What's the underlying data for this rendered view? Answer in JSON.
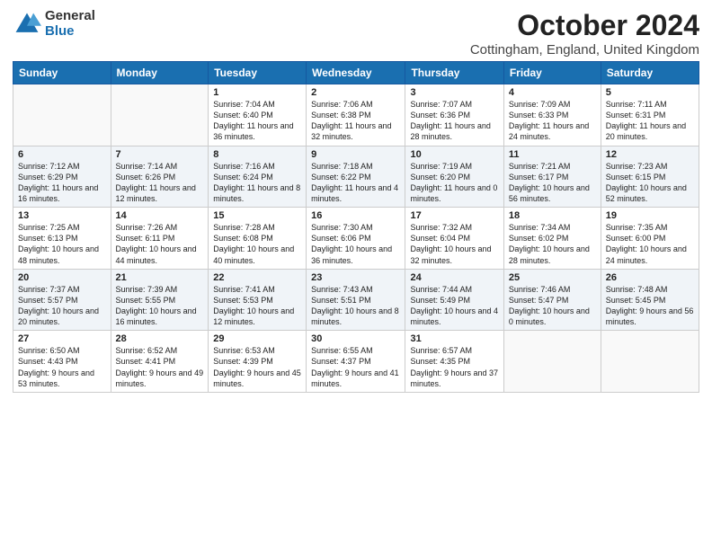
{
  "logo": {
    "general": "General",
    "blue": "Blue"
  },
  "header": {
    "title": "October 2024",
    "subtitle": "Cottingham, England, United Kingdom"
  },
  "weekdays": [
    "Sunday",
    "Monday",
    "Tuesday",
    "Wednesday",
    "Thursday",
    "Friday",
    "Saturday"
  ],
  "weeks": [
    [
      null,
      null,
      {
        "day": "1",
        "sunrise": "Sunrise: 7:04 AM",
        "sunset": "Sunset: 6:40 PM",
        "daylight": "Daylight: 11 hours and 36 minutes."
      },
      {
        "day": "2",
        "sunrise": "Sunrise: 7:06 AM",
        "sunset": "Sunset: 6:38 PM",
        "daylight": "Daylight: 11 hours and 32 minutes."
      },
      {
        "day": "3",
        "sunrise": "Sunrise: 7:07 AM",
        "sunset": "Sunset: 6:36 PM",
        "daylight": "Daylight: 11 hours and 28 minutes."
      },
      {
        "day": "4",
        "sunrise": "Sunrise: 7:09 AM",
        "sunset": "Sunset: 6:33 PM",
        "daylight": "Daylight: 11 hours and 24 minutes."
      },
      {
        "day": "5",
        "sunrise": "Sunrise: 7:11 AM",
        "sunset": "Sunset: 6:31 PM",
        "daylight": "Daylight: 11 hours and 20 minutes."
      }
    ],
    [
      {
        "day": "6",
        "sunrise": "Sunrise: 7:12 AM",
        "sunset": "Sunset: 6:29 PM",
        "daylight": "Daylight: 11 hours and 16 minutes."
      },
      {
        "day": "7",
        "sunrise": "Sunrise: 7:14 AM",
        "sunset": "Sunset: 6:26 PM",
        "daylight": "Daylight: 11 hours and 12 minutes."
      },
      {
        "day": "8",
        "sunrise": "Sunrise: 7:16 AM",
        "sunset": "Sunset: 6:24 PM",
        "daylight": "Daylight: 11 hours and 8 minutes."
      },
      {
        "day": "9",
        "sunrise": "Sunrise: 7:18 AM",
        "sunset": "Sunset: 6:22 PM",
        "daylight": "Daylight: 11 hours and 4 minutes."
      },
      {
        "day": "10",
        "sunrise": "Sunrise: 7:19 AM",
        "sunset": "Sunset: 6:20 PM",
        "daylight": "Daylight: 11 hours and 0 minutes."
      },
      {
        "day": "11",
        "sunrise": "Sunrise: 7:21 AM",
        "sunset": "Sunset: 6:17 PM",
        "daylight": "Daylight: 10 hours and 56 minutes."
      },
      {
        "day": "12",
        "sunrise": "Sunrise: 7:23 AM",
        "sunset": "Sunset: 6:15 PM",
        "daylight": "Daylight: 10 hours and 52 minutes."
      }
    ],
    [
      {
        "day": "13",
        "sunrise": "Sunrise: 7:25 AM",
        "sunset": "Sunset: 6:13 PM",
        "daylight": "Daylight: 10 hours and 48 minutes."
      },
      {
        "day": "14",
        "sunrise": "Sunrise: 7:26 AM",
        "sunset": "Sunset: 6:11 PM",
        "daylight": "Daylight: 10 hours and 44 minutes."
      },
      {
        "day": "15",
        "sunrise": "Sunrise: 7:28 AM",
        "sunset": "Sunset: 6:08 PM",
        "daylight": "Daylight: 10 hours and 40 minutes."
      },
      {
        "day": "16",
        "sunrise": "Sunrise: 7:30 AM",
        "sunset": "Sunset: 6:06 PM",
        "daylight": "Daylight: 10 hours and 36 minutes."
      },
      {
        "day": "17",
        "sunrise": "Sunrise: 7:32 AM",
        "sunset": "Sunset: 6:04 PM",
        "daylight": "Daylight: 10 hours and 32 minutes."
      },
      {
        "day": "18",
        "sunrise": "Sunrise: 7:34 AM",
        "sunset": "Sunset: 6:02 PM",
        "daylight": "Daylight: 10 hours and 28 minutes."
      },
      {
        "day": "19",
        "sunrise": "Sunrise: 7:35 AM",
        "sunset": "Sunset: 6:00 PM",
        "daylight": "Daylight: 10 hours and 24 minutes."
      }
    ],
    [
      {
        "day": "20",
        "sunrise": "Sunrise: 7:37 AM",
        "sunset": "Sunset: 5:57 PM",
        "daylight": "Daylight: 10 hours and 20 minutes."
      },
      {
        "day": "21",
        "sunrise": "Sunrise: 7:39 AM",
        "sunset": "Sunset: 5:55 PM",
        "daylight": "Daylight: 10 hours and 16 minutes."
      },
      {
        "day": "22",
        "sunrise": "Sunrise: 7:41 AM",
        "sunset": "Sunset: 5:53 PM",
        "daylight": "Daylight: 10 hours and 12 minutes."
      },
      {
        "day": "23",
        "sunrise": "Sunrise: 7:43 AM",
        "sunset": "Sunset: 5:51 PM",
        "daylight": "Daylight: 10 hours and 8 minutes."
      },
      {
        "day": "24",
        "sunrise": "Sunrise: 7:44 AM",
        "sunset": "Sunset: 5:49 PM",
        "daylight": "Daylight: 10 hours and 4 minutes."
      },
      {
        "day": "25",
        "sunrise": "Sunrise: 7:46 AM",
        "sunset": "Sunset: 5:47 PM",
        "daylight": "Daylight: 10 hours and 0 minutes."
      },
      {
        "day": "26",
        "sunrise": "Sunrise: 7:48 AM",
        "sunset": "Sunset: 5:45 PM",
        "daylight": "Daylight: 9 hours and 56 minutes."
      }
    ],
    [
      {
        "day": "27",
        "sunrise": "Sunrise: 6:50 AM",
        "sunset": "Sunset: 4:43 PM",
        "daylight": "Daylight: 9 hours and 53 minutes."
      },
      {
        "day": "28",
        "sunrise": "Sunrise: 6:52 AM",
        "sunset": "Sunset: 4:41 PM",
        "daylight": "Daylight: 9 hours and 49 minutes."
      },
      {
        "day": "29",
        "sunrise": "Sunrise: 6:53 AM",
        "sunset": "Sunset: 4:39 PM",
        "daylight": "Daylight: 9 hours and 45 minutes."
      },
      {
        "day": "30",
        "sunrise": "Sunrise: 6:55 AM",
        "sunset": "Sunset: 4:37 PM",
        "daylight": "Daylight: 9 hours and 41 minutes."
      },
      {
        "day": "31",
        "sunrise": "Sunrise: 6:57 AM",
        "sunset": "Sunset: 4:35 PM",
        "daylight": "Daylight: 9 hours and 37 minutes."
      },
      null,
      null
    ]
  ]
}
